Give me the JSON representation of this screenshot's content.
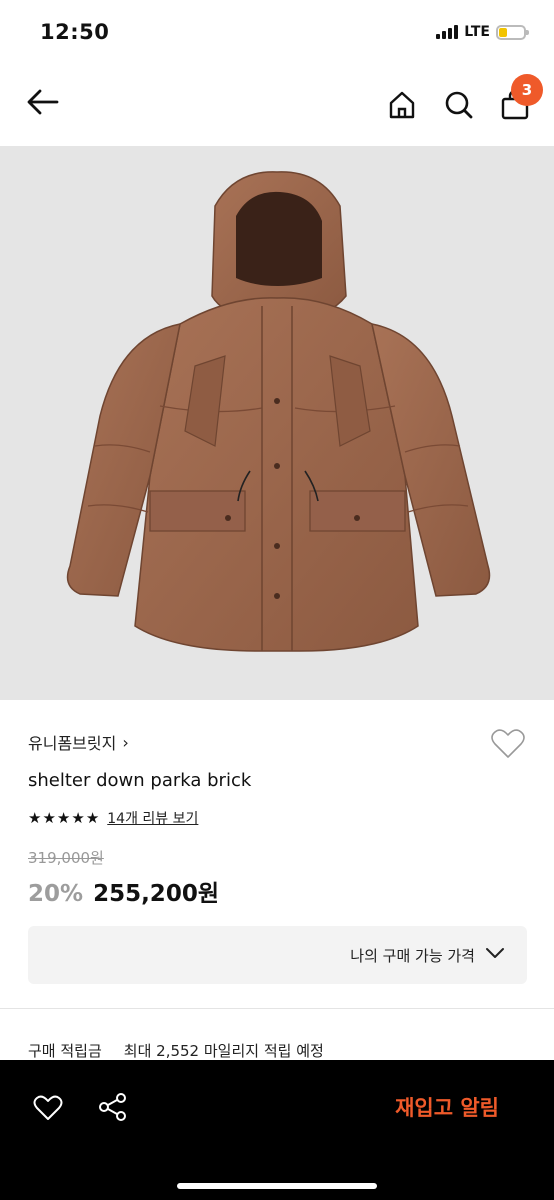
{
  "status": {
    "time": "12:50",
    "network": "LTE",
    "battery_level": 0.35
  },
  "nav": {
    "icons": [
      "back-arrow-icon",
      "home-icon",
      "search-icon",
      "shopping-bag-icon"
    ],
    "cart_count": "3",
    "badge_color": "#ef5a2a"
  },
  "product": {
    "image_subject": "brick-colored hooded down parka",
    "brand": "유니폼브릿지",
    "brand_chevron": "›",
    "name": "shelter down parka brick",
    "rating": 5,
    "review_link": "14개 리뷰 보기",
    "original_price": "319,000원",
    "discount": "20%",
    "sale_price": "255,200원",
    "purchase_price_label": "나의 구매 가능 가격",
    "points_label": "구매 적립금",
    "points_value": "최대 2,552 마일리지 적립 예정"
  },
  "bottom_bar": {
    "restock_label": "재입고 알림",
    "accent_color": "#ef5a2a"
  }
}
